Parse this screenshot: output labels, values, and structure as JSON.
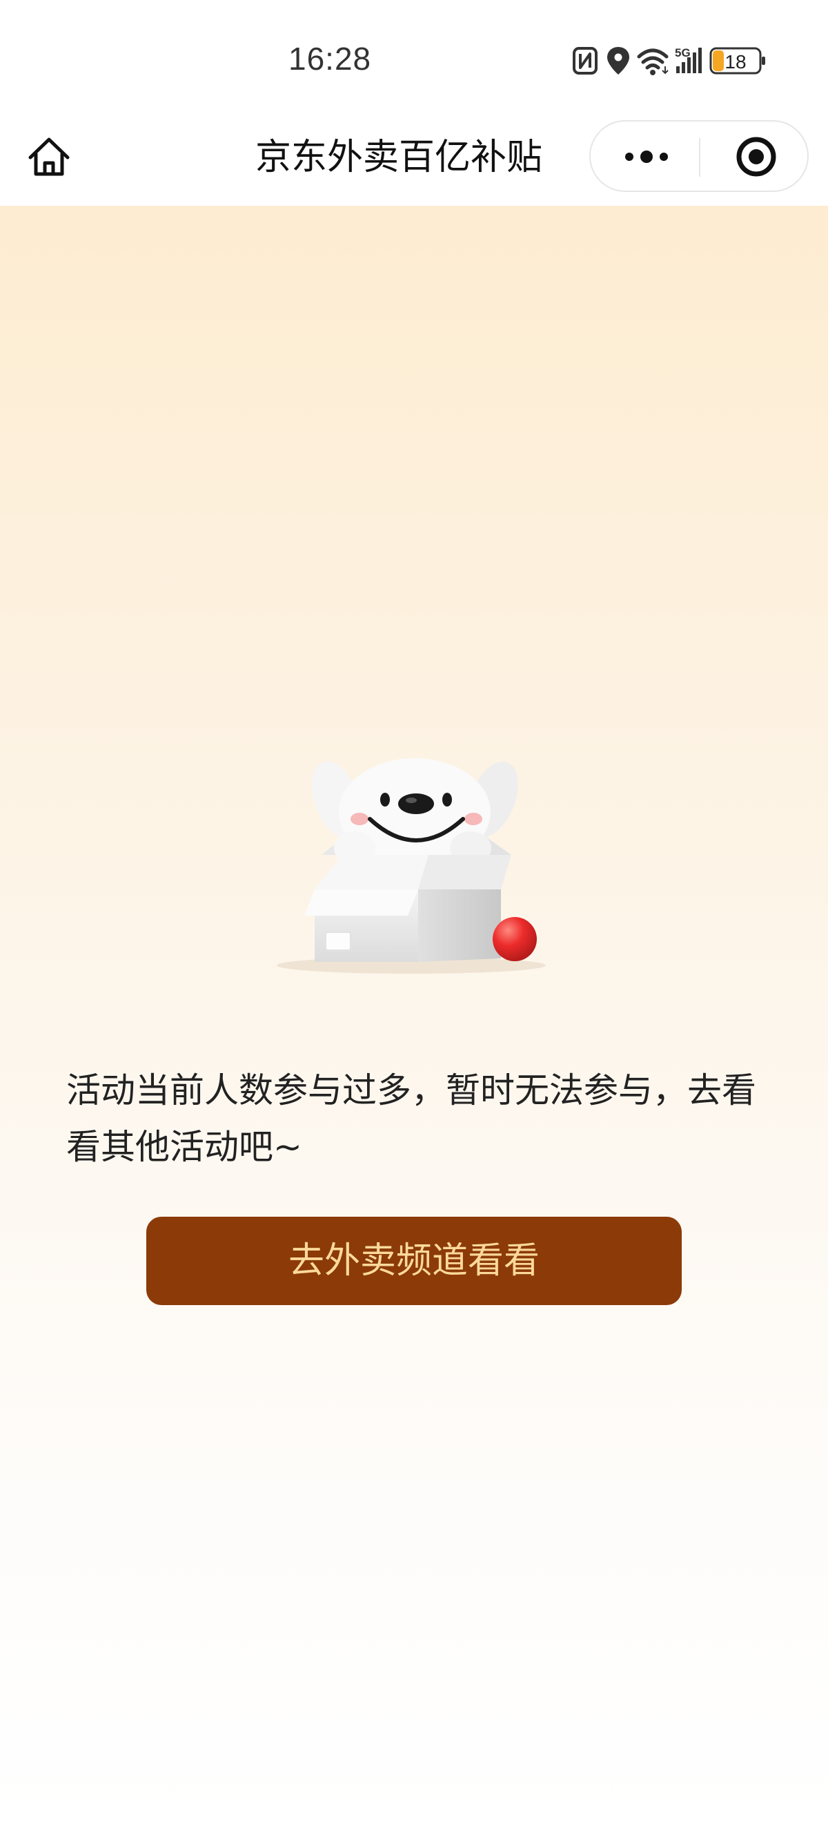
{
  "status_bar": {
    "time": "16:28",
    "battery_level": "18",
    "network": "5G",
    "icons": [
      "nfc-icon",
      "location-icon",
      "wifi-icon",
      "signal-icon",
      "battery-icon"
    ]
  },
  "nav": {
    "title": "京东外卖百亿补贴",
    "home_icon": "home-icon",
    "more_icon": "more-dots-icon",
    "close_icon": "target-close-icon"
  },
  "main": {
    "message": "活动当前人数参与过多，暂时无法参与，去看看其他活动吧~",
    "cta_label": "去外卖频道看看"
  },
  "colors": {
    "cta_background": "#8b3a08",
    "cta_text": "#fcd99b",
    "page_top": "#fdecd1",
    "page_bottom": "#ffffff",
    "ball": "#ec2b2b"
  }
}
